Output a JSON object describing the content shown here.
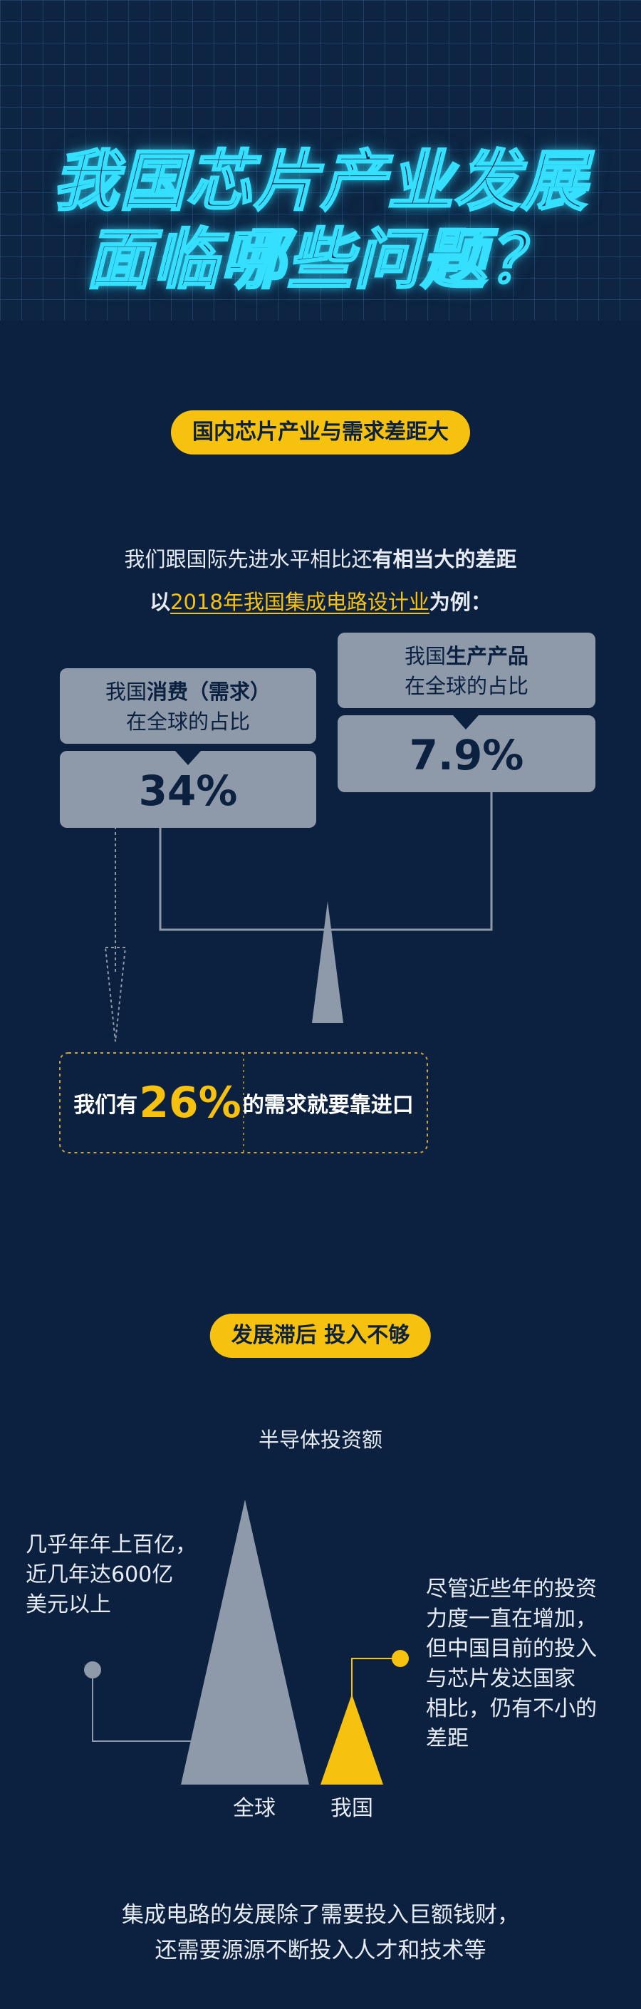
{
  "title": {
    "line1": "我国芯片产业发展",
    "line2": "面临哪些问题？"
  },
  "section1": {
    "pill": "国内芯片产业与需求差距大",
    "intro_part1": "我们跟国际先进水平相比还",
    "intro_part1_bold": "有相当大的差距",
    "intro_part2_prefix": "以",
    "intro_part2_highlight": "2018年我国集成电路设计业",
    "intro_part2_suffix": "为例：",
    "consumption": {
      "label_prefix": "我国",
      "label_bold": "消费（需求）",
      "label_line2": "在全球的占比",
      "value": "34%"
    },
    "production": {
      "label_prefix": "我国",
      "label_bold": "生产产品",
      "label_line2": "在全球的占比",
      "value": "7.9%"
    },
    "import": {
      "prefix": "我们有",
      "value": "26%",
      "suffix": "的需求就要靠进口"
    }
  },
  "section2": {
    "pill": "发展滞后 投入不够",
    "chart_title": "半导体投资额",
    "left_note": [
      "几乎年年上百亿，",
      "近几年达600亿",
      "美元以上"
    ],
    "right_note": [
      "尽管近些年的投资",
      "力度一直在增加，",
      "但中国目前的投入",
      "与芯片发达国家",
      "相比，仍有不小的",
      "差距"
    ],
    "label_global": "全球",
    "label_china": "我国",
    "colors": {
      "global": "#8e9aaa",
      "china": "#f7c20f"
    }
  },
  "footer": {
    "line1": "集成电路的发展除了需要投入巨额钱财，",
    "line2": "还需要源源不断投入人才和技术等"
  }
}
